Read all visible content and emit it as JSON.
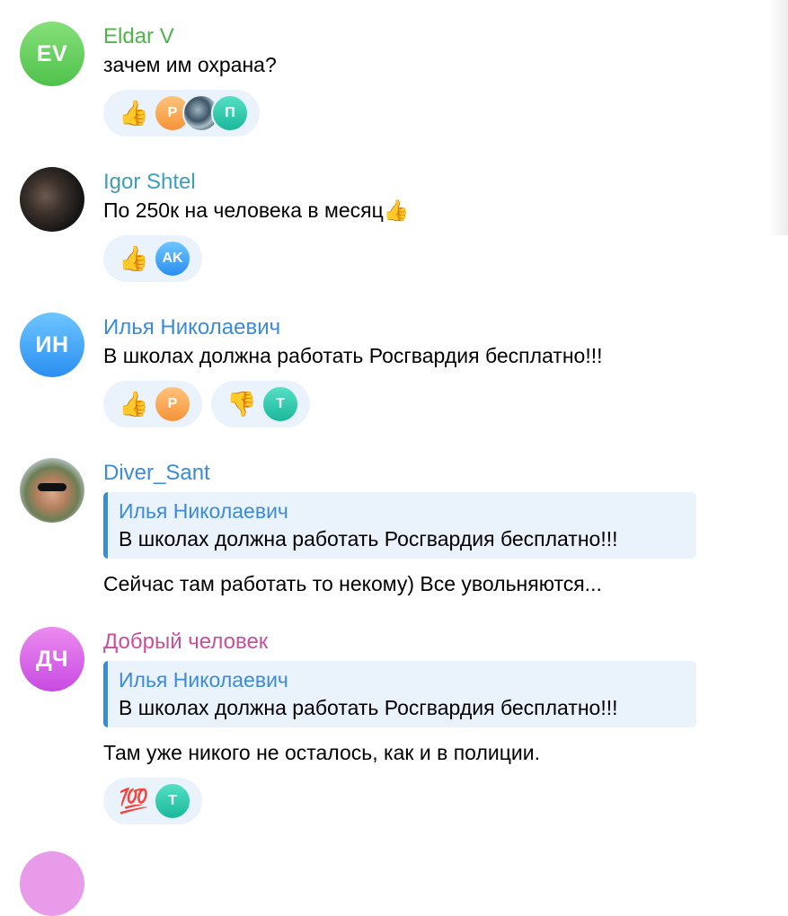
{
  "messages": [
    {
      "author": "Eldar V",
      "author_color": "#4fb34a",
      "avatar_initials": "EV",
      "text": "зачем им охрана?",
      "reactions": [
        {
          "emoji": "👍",
          "avatars": [
            "Р",
            "",
            "П"
          ]
        }
      ]
    },
    {
      "author": "Igor Shtel",
      "author_color": "#3e9eb8",
      "avatar_initials": "",
      "text": "По 250к на человека в месяц👍",
      "reactions": [
        {
          "emoji": "👍",
          "avatars": [
            "AK"
          ]
        }
      ]
    },
    {
      "author": "Илья Николаевич",
      "author_color": "#3a8bd8",
      "avatar_initials": "ИН",
      "text": "В школах должна работать Росгвардия бесплатно!!!",
      "reactions": [
        {
          "emoji": "👍",
          "avatars": [
            "Р"
          ]
        },
        {
          "emoji": "👎",
          "avatars": [
            "Т"
          ]
        }
      ]
    },
    {
      "author": "Diver_Sant",
      "author_color": "#3a8bd8",
      "avatar_initials": "",
      "quote": {
        "author": "Илья Николаевич",
        "text": "В школах должна работать Росгвардия бесплатно!!!"
      },
      "text": "Сейчас там работать то некому) Все увольняются..."
    },
    {
      "author": "Добрый человек",
      "author_color": "#c8509a",
      "avatar_initials": "ДЧ",
      "quote": {
        "author": "Илья Николаевич",
        "text": "В школах должна работать Росгвардия бесплатно!!!"
      },
      "text": "Там уже никого не осталось, как и в полиции.",
      "reactions": [
        {
          "emoji": "💯",
          "avatars": [
            "Т"
          ]
        }
      ]
    }
  ]
}
